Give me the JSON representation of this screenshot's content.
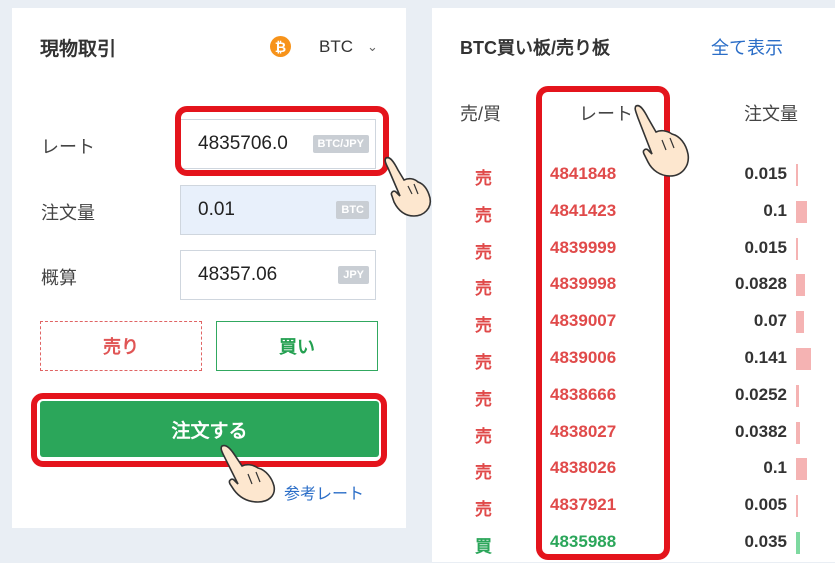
{
  "panel": {
    "title": "現物取引",
    "coin_symbol": "₿",
    "pair": "BTC",
    "rate_label": "レート",
    "rate_value": "4835706.0",
    "rate_unit": "BTC/JPY",
    "amount_label": "注文量",
    "amount_value": "0.01",
    "amount_unit": "BTC",
    "estimate_label": "概算",
    "estimate_value": "48357.06",
    "estimate_unit": "JPY",
    "sell_label": "売り",
    "buy_label": "買い",
    "order_label": "注文する",
    "ref_rate_label": "参考レート"
  },
  "orderbook": {
    "title": "BTC買い板/売り板",
    "show_all": "全て表示",
    "col_side": "売/買",
    "col_rate": "レート",
    "col_qty": "注文量",
    "rows": [
      {
        "side": "売",
        "rate": "4841848",
        "qty": "0.015",
        "bar": 0.08,
        "type": "sell"
      },
      {
        "side": "売",
        "rate": "4841423",
        "qty": "0.1",
        "bar": 0.55,
        "type": "sell"
      },
      {
        "side": "売",
        "rate": "4839999",
        "qty": "0.015",
        "bar": 0.08,
        "type": "sell"
      },
      {
        "side": "売",
        "rate": "4839998",
        "qty": "0.0828",
        "bar": 0.45,
        "type": "sell"
      },
      {
        "side": "売",
        "rate": "4839007",
        "qty": "0.07",
        "bar": 0.38,
        "type": "sell"
      },
      {
        "side": "売",
        "rate": "4839006",
        "qty": "0.141",
        "bar": 0.77,
        "type": "sell"
      },
      {
        "side": "売",
        "rate": "4838666",
        "qty": "0.0252",
        "bar": 0.14,
        "type": "sell"
      },
      {
        "side": "売",
        "rate": "4838027",
        "qty": "0.0382",
        "bar": 0.21,
        "type": "sell"
      },
      {
        "side": "売",
        "rate": "4838026",
        "qty": "0.1",
        "bar": 0.55,
        "type": "sell"
      },
      {
        "side": "売",
        "rate": "4837921",
        "qty": "0.005",
        "bar": 0.03,
        "type": "sell"
      },
      {
        "side": "買",
        "rate": "4835988",
        "qty": "0.035",
        "bar": 0.19,
        "type": "buy"
      }
    ]
  },
  "colors": {
    "sell": "#e04a4a",
    "buy": "#2ba65a",
    "sell_bar": "#f5b3b3",
    "buy_bar": "#7ed9a0",
    "highlight": "#e4141c"
  }
}
